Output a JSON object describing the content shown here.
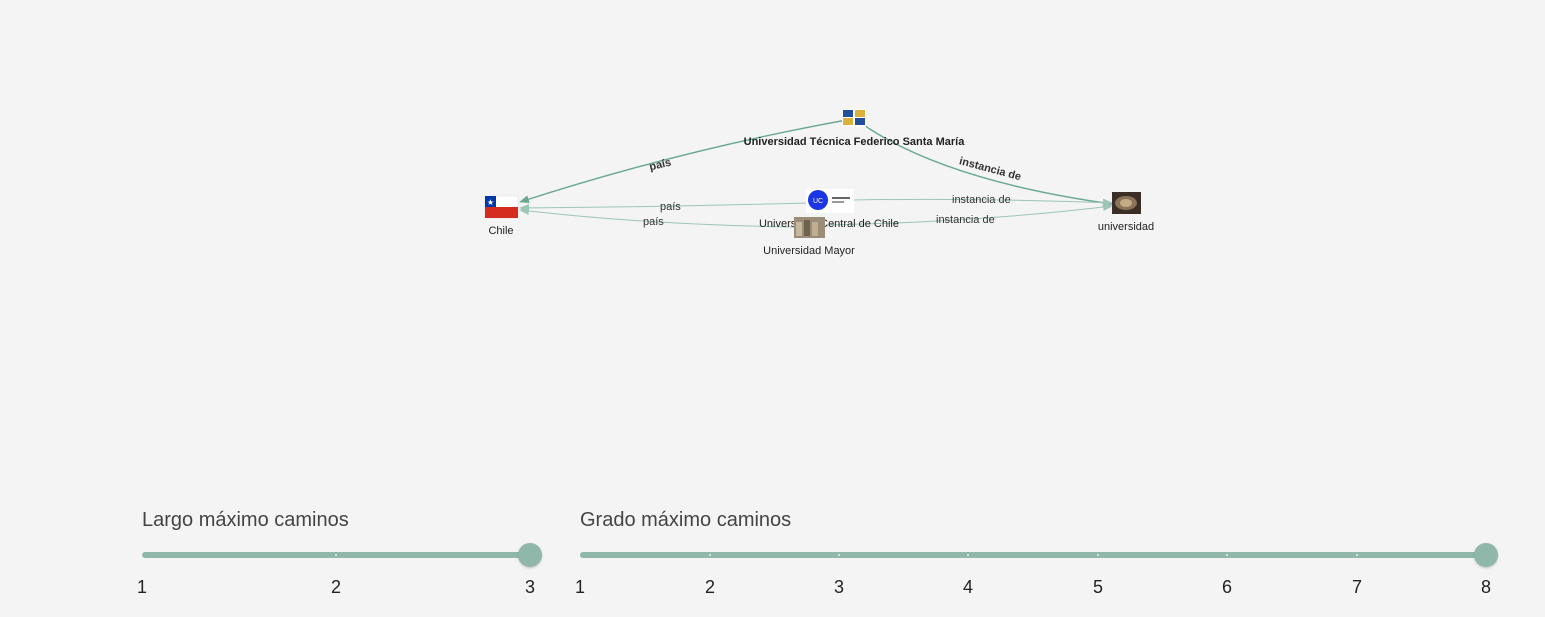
{
  "graph": {
    "nodes": {
      "chile": {
        "label": "Chile",
        "icon": "chile-flag-icon"
      },
      "utfsm": {
        "label": "Universidad Técnica Federico Santa María",
        "icon": "utfsm-crest-icon"
      },
      "ucentral": {
        "label": "Universidad Central de Chile",
        "icon": "ucentral-logo-icon"
      },
      "umayor": {
        "label": "Universidad Mayor",
        "icon": "umayor-photo-icon"
      },
      "universidad": {
        "label": "universidad",
        "icon": "universidad-photo-icon"
      }
    },
    "edges": {
      "utfsm_pais": "país",
      "utfsm_instancia": "instancia de",
      "ucentral_pais": "país",
      "ucentral_instancia": "instancia de",
      "umayor_pais": "país",
      "umayor_instancia": "instancia de"
    },
    "colors": {
      "edge": "#6aa891",
      "edge_light": "#9cc6b6"
    }
  },
  "sliders": {
    "largo": {
      "title": "Largo máximo caminos",
      "min": 1,
      "max": 3,
      "value": 3,
      "ticks": [
        "1",
        "2",
        "3"
      ]
    },
    "grado": {
      "title": "Grado máximo caminos",
      "min": 1,
      "max": 8,
      "value": 8,
      "ticks": [
        "1",
        "2",
        "3",
        "4",
        "5",
        "6",
        "7",
        "8"
      ]
    },
    "color": "#8fb8aa"
  }
}
